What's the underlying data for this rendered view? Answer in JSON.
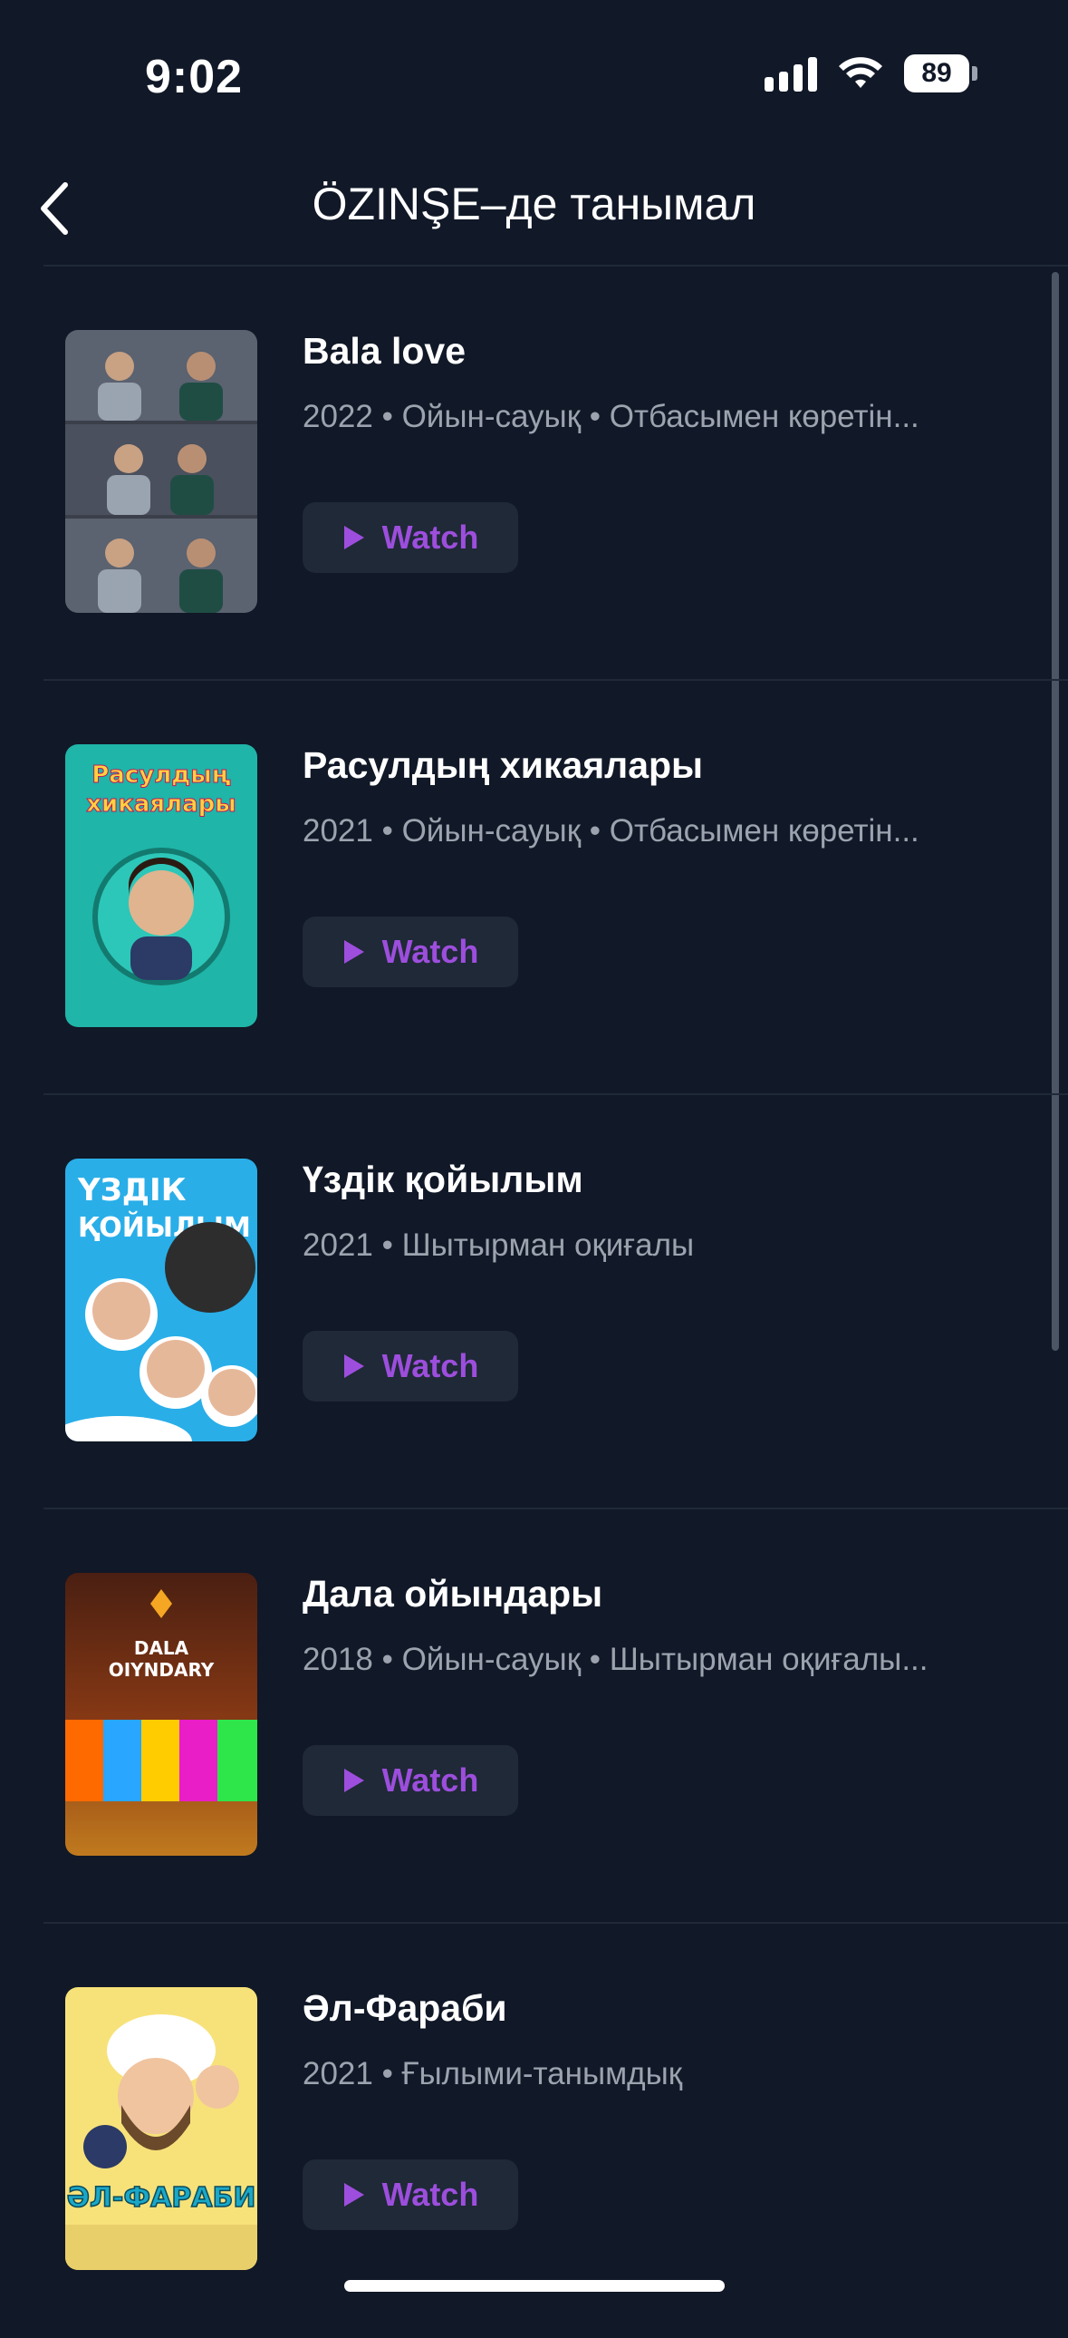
{
  "status_bar": {
    "time": "9:02",
    "battery": "89",
    "icons": [
      "signal-icon",
      "wifi-icon",
      "battery-icon"
    ]
  },
  "header": {
    "title": "ÖZINŞE–де танымал",
    "back_icon": "chevron-left-icon"
  },
  "items": [
    {
      "title": "Bala love",
      "meta": "2022 • Ойын-сауық • Отбасымен көретін...",
      "watch_label": "Watch"
    },
    {
      "title": "Расулдың хикаялары",
      "meta": "2021 • Ойын-сауық • Отбасымен көретін...",
      "watch_label": "Watch",
      "poster_text": [
        "Расулдың",
        "хикаялары"
      ]
    },
    {
      "title": "Үздік қойылым",
      "meta": "2021 • Шытырман оқиғалы",
      "watch_label": "Watch",
      "poster_text": [
        "ҮЗДІК",
        "ҚОЙЫЛЫМ"
      ]
    },
    {
      "title": "Дала ойындары",
      "meta": "2018 • Ойын-сауық • Шытырман оқиғалы...",
      "watch_label": "Watch",
      "poster_text": [
        "DALA",
        "OIYNDARY"
      ]
    },
    {
      "title": "Әл-Фараби",
      "meta": "2021 • Ғылыми-танымдық",
      "watch_label": "Watch",
      "poster_text": [
        "ӘЛ-ФАРАБИ"
      ]
    }
  ],
  "colors": {
    "background": "#111827",
    "accent": "#9d4edd",
    "button_bg": "#1f2937",
    "meta_text": "#9ca3af"
  }
}
